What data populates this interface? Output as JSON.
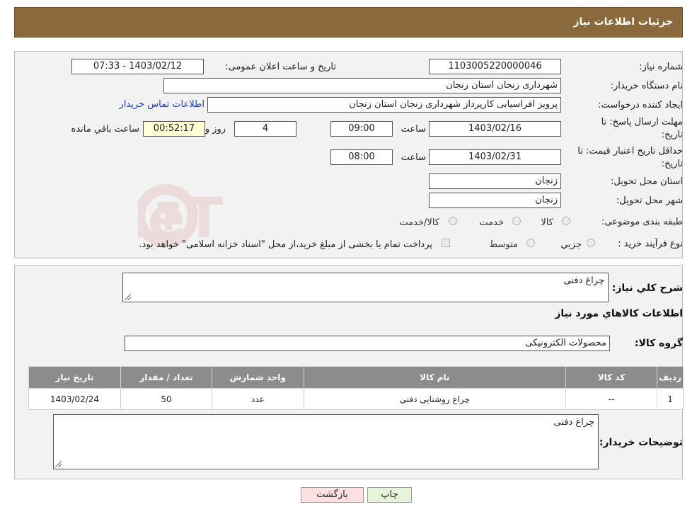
{
  "header": {
    "title": "جزئیات اطلاعات نیاز"
  },
  "form": {
    "need_number_label": "شماره نیاز:",
    "need_number": "1103005220000046",
    "announce_label": "تاریخ و ساعت اعلان عمومی:",
    "announce_value": "1403/02/12 - 07:33",
    "buyer_org_label": "نام دستگاه خریدار:",
    "buyer_org": "شهرداری زنجان استان زنجان",
    "creator_label": "ایجاد کننده درخواست:",
    "creator": "پرویز افراسیابی کارپرداز شهرداری زنجان استان زنجان",
    "contact_link": "اطلاعات تماس خریدار",
    "deadline_label_line1": "مهلت ارسال پاسخ: تا",
    "deadline_label_line2": "تاریخ:",
    "deadline_date": "1403/02/16",
    "time_label": "ساعت",
    "deadline_time": "09:00",
    "days_value": "4",
    "days_label": "روز و",
    "remaining_time": "00:52:17",
    "remaining_label": "ساعت باقي مانده",
    "validity_label_line1": "حداقل تاریخ اعتبار قیمت: تا",
    "validity_label_line2": "تاریخ:",
    "validity_date": "1403/02/31",
    "validity_time_label": "ساعت",
    "validity_time": "08:00",
    "province_label": "استان محل تحویل:",
    "province": "زنجان",
    "city_label": "شهر محل تحویل:",
    "city": "زنجان",
    "category_label": "طبقه بندی موضوعی:",
    "category_options": [
      "کالا",
      "خدمت",
      "کالا/خدمت"
    ],
    "process_label": "نوع فرآیند خرید :",
    "process_options": [
      "جزیي",
      "متوسط"
    ],
    "payment_note": "پرداخت تمام یا بخشی از مبلغ خرید،از محل \"اسناد خزانه اسلامی\" خواهد بود."
  },
  "details": {
    "summary_label": "شرح کلي نیاز:",
    "summary": "چراغ دفنی",
    "goods_info_title": "اطلاعات کالاهاي مورد نیاز",
    "group_label": "گروه کالا:",
    "group": "محصولات الکترونیکی",
    "table": {
      "headers": [
        "ردیف",
        "کد کالا",
        "نام کالا",
        "واحد شمارش",
        "تعداد / مقدار",
        "تاریخ نیاز"
      ],
      "rows": [
        [
          "1",
          "--",
          "چراغ روشنایی دفنی",
          "عدد",
          "50",
          "1403/02/24"
        ]
      ]
    },
    "buyer_notes_label": "توضیحات خریدار:",
    "buyer_notes": "چراغ دفنی"
  },
  "buttons": {
    "print": "چاپ",
    "back": "بازگشت"
  },
  "watermark": {
    "text": "AriaTender.neT"
  },
  "colors": {
    "header": "#8a6a3c",
    "table_header": "#8c8c8c",
    "back_button": "#fde0e0",
    "print_button": "#e6f5d8",
    "remaining_bg": "#ffffd4"
  }
}
